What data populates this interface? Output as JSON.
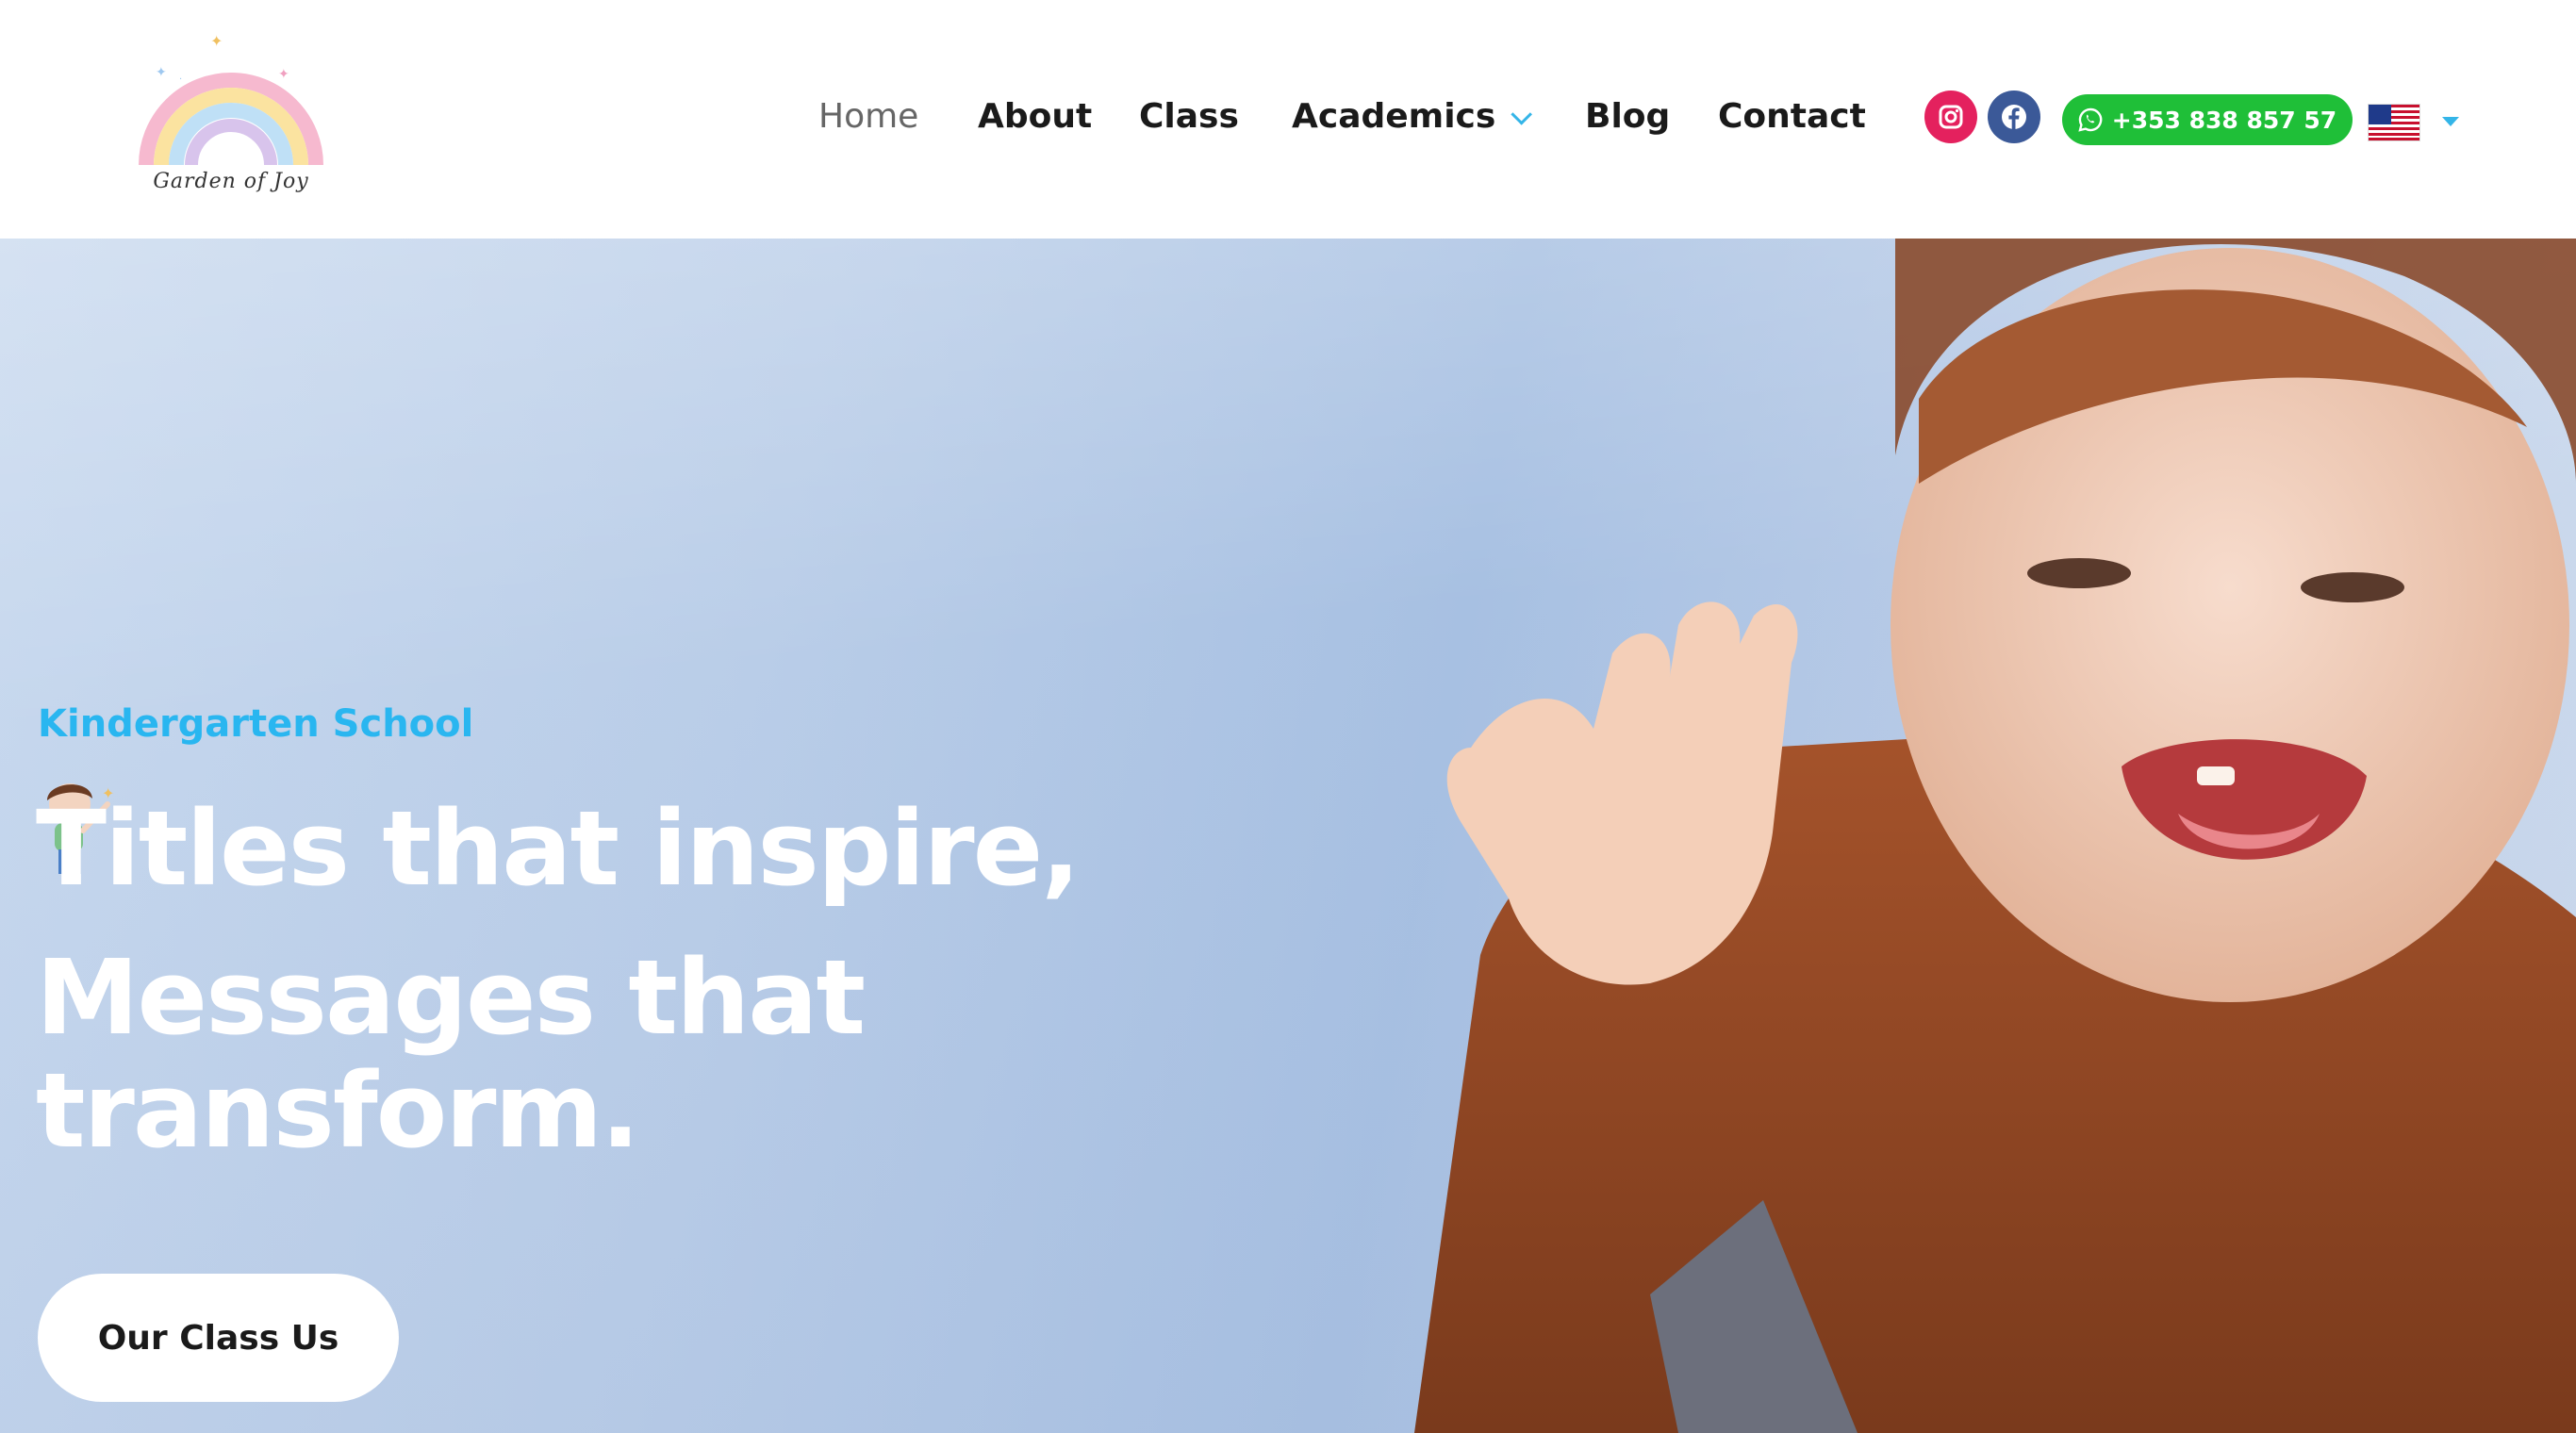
{
  "brand": {
    "logo_text": "Garden of Joy"
  },
  "nav": {
    "items": [
      {
        "label": "Home",
        "active": true
      },
      {
        "label": "About"
      },
      {
        "label": "Class"
      },
      {
        "label": "Academics",
        "has_dropdown": true
      },
      {
        "label": "Blog"
      },
      {
        "label": "Contact"
      }
    ]
  },
  "social": {
    "instagram_icon": "instagram-icon",
    "facebook_icon": "facebook-icon"
  },
  "whatsapp": {
    "label": "+353 838 857 57",
    "icon": "whatsapp-icon"
  },
  "language": {
    "flag": "us-flag-icon"
  },
  "hero": {
    "kicker": "Kindergarten School",
    "title_line1": "Titles that inspire,",
    "title_line2": "Messages that transform.",
    "cta_label": "Our Class Us"
  },
  "colors": {
    "accent": "#29b6f0",
    "whatsapp_green": "#1fbf38",
    "instagram": "#e4215e",
    "facebook": "#3b5998"
  }
}
